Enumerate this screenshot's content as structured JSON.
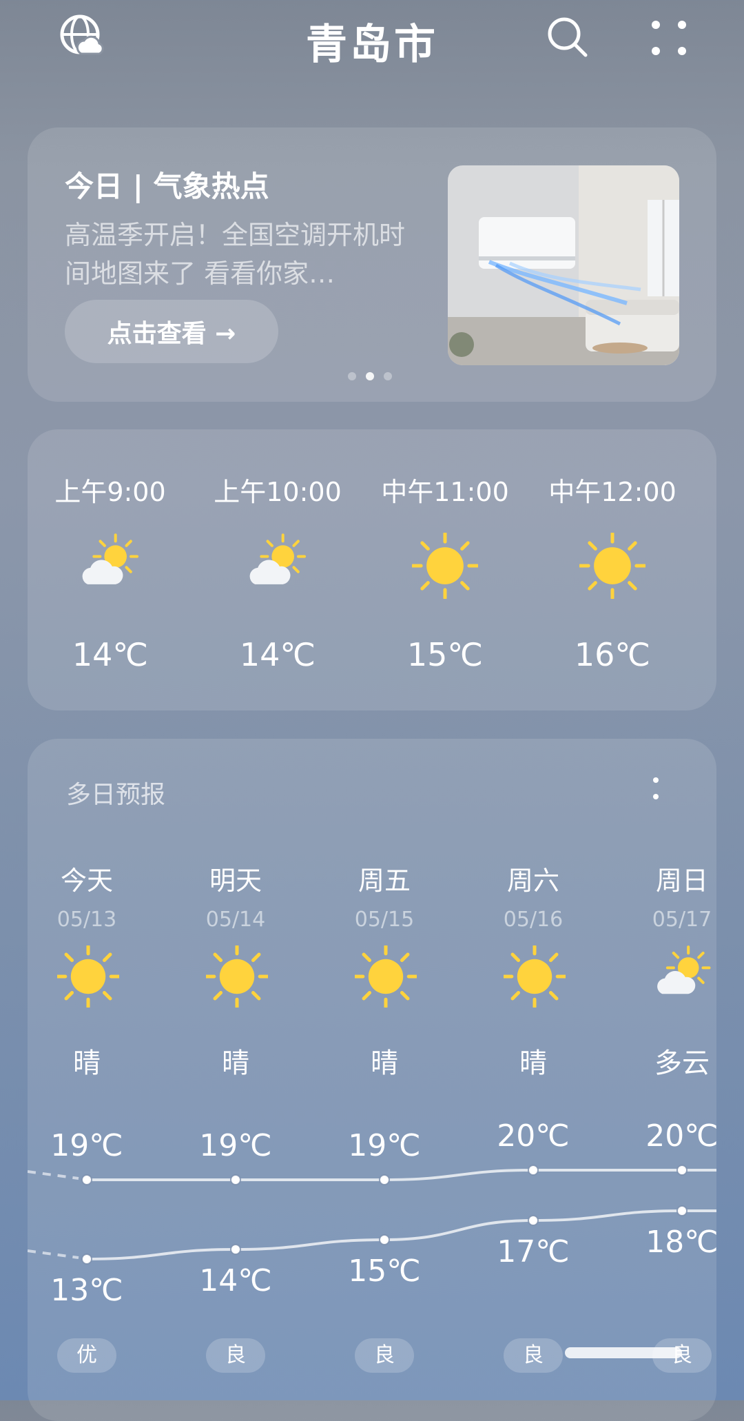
{
  "header": {
    "city": "青岛市",
    "left_icon": "globe-weather-icon",
    "search_icon": "search-icon",
    "menu_icon": "grid-dots-icon"
  },
  "news": {
    "title": "今日 | 气象热点",
    "desc": "高温季开启！全国空调开机时间地图来了 看看你家…",
    "button": "点击查看 →",
    "page_count": 3,
    "active_page": 2
  },
  "hourly": [
    {
      "time": "上午9:00",
      "icon": "partly-cloudy-icon",
      "temp": "14℃"
    },
    {
      "time": "上午10:00",
      "icon": "partly-cloudy-icon",
      "temp": "14℃"
    },
    {
      "time": "中午11:00",
      "icon": "sunny-icon",
      "temp": "15℃"
    },
    {
      "time": "中午12:00",
      "icon": "sunny-icon",
      "temp": "16℃"
    }
  ],
  "daily": {
    "title": "多日预报",
    "days": [
      {
        "day": "今天",
        "date": "05/13",
        "icon": "sunny-icon",
        "cond": "晴",
        "hi": "19℃",
        "lo": "13℃",
        "hi_v": 19,
        "lo_v": 13,
        "aqi": "优"
      },
      {
        "day": "明天",
        "date": "05/14",
        "icon": "sunny-icon",
        "cond": "晴",
        "hi": "19℃",
        "lo": "14℃",
        "hi_v": 19,
        "lo_v": 14,
        "aqi": "良"
      },
      {
        "day": "周五",
        "date": "05/15",
        "icon": "sunny-icon",
        "cond": "晴",
        "hi": "19℃",
        "lo": "15℃",
        "hi_v": 19,
        "lo_v": 15,
        "aqi": "良"
      },
      {
        "day": "周六",
        "date": "05/16",
        "icon": "sunny-icon",
        "cond": "晴",
        "hi": "20℃",
        "lo": "17℃",
        "hi_v": 20,
        "lo_v": 17,
        "aqi": "良"
      },
      {
        "day": "周日",
        "date": "05/17",
        "icon": "partly-cloudy-icon",
        "cond": "多云",
        "hi": "20℃",
        "lo": "18℃",
        "hi_v": 20,
        "lo_v": 18,
        "aqi": "良"
      }
    ]
  },
  "colors": {
    "sun": "#ffd33d",
    "cloud": "#f2f4f7"
  }
}
